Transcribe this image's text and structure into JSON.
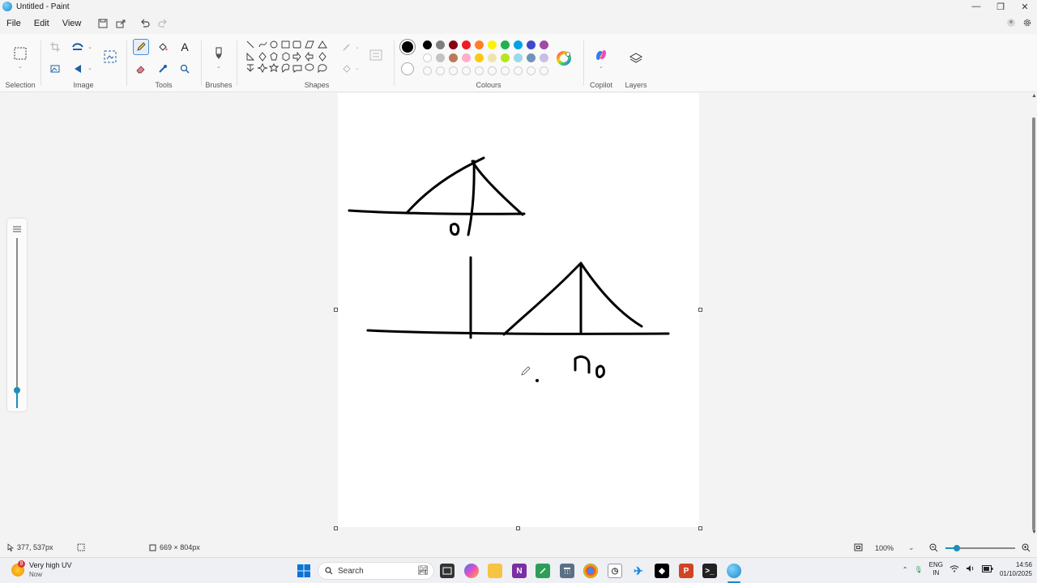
{
  "window": {
    "title": "Untitled - Paint",
    "controls": [
      "—",
      "❐",
      "✕"
    ]
  },
  "menu": {
    "items": [
      "File",
      "Edit",
      "View"
    ]
  },
  "ribbon": {
    "groups": {
      "selection": "Selection",
      "image": "Image",
      "tools": "Tools",
      "brushes": "Brushes",
      "shapes": "Shapes",
      "colours": "Colours",
      "copilot": "Copilot",
      "layers": "Layers"
    },
    "tools_text_glyph": "A",
    "active_tool": "pencil",
    "palette_row1": [
      "#000000",
      "#7f7f7f",
      "#880015",
      "#ed1c24",
      "#ff7f27",
      "#fff200",
      "#22b14c",
      "#00a2e8",
      "#3f48cc",
      "#a349a4"
    ],
    "palette_row2": [
      "#ffffff",
      "#c3c3c3",
      "#b97a57",
      "#ffaec9",
      "#ffc90e",
      "#efe4b0",
      "#b5e61d",
      "#99d9ea",
      "#7092be",
      "#c8bfe7"
    ],
    "primary_color": "#000000",
    "secondary_color": "#ffffff"
  },
  "status": {
    "cursor_pos": "377, 537px",
    "canvas_size": "669 × 804px",
    "zoom": "100%"
  },
  "taskbar": {
    "weather_title": "Very high UV",
    "weather_sub": "Now",
    "weather_badge": "9",
    "search_placeholder": "Search",
    "lang_top": "ENG",
    "lang_bottom": "IN",
    "time": "14:56",
    "date": "01/10/2025"
  }
}
